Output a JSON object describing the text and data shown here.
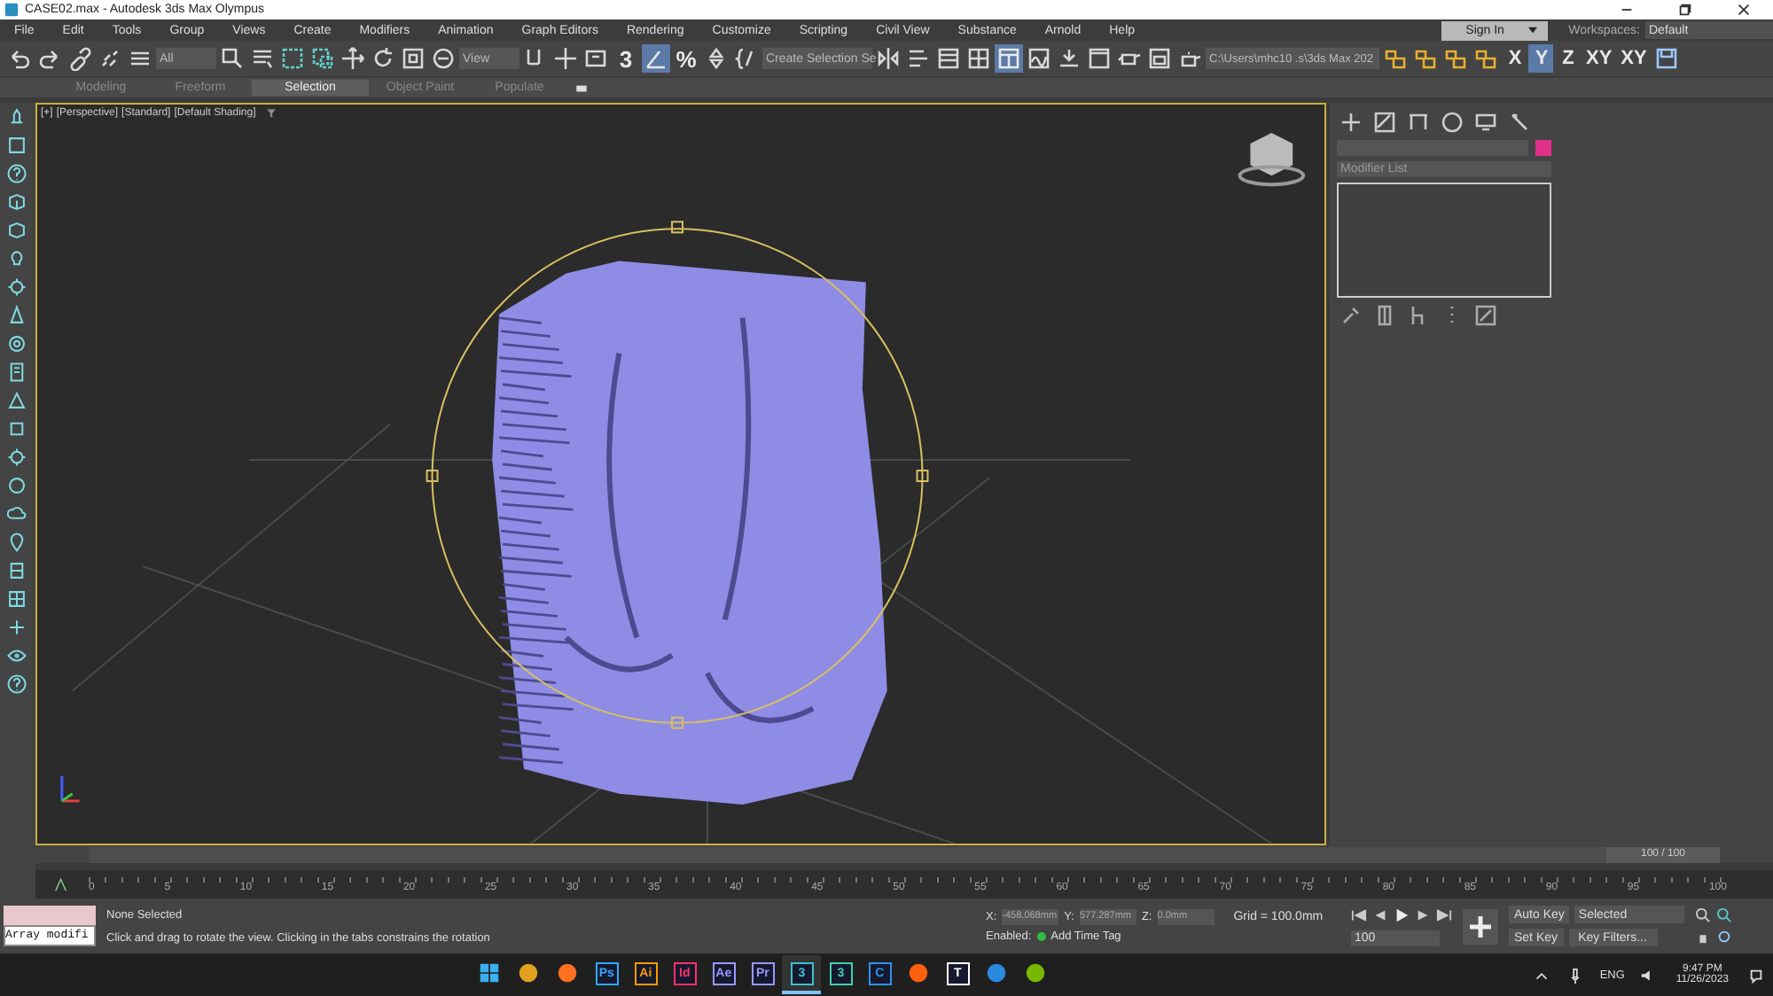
{
  "window": {
    "title": "CASE02.max - Autodesk 3ds Max Olympus"
  },
  "menu": [
    "File",
    "Edit",
    "Tools",
    "Group",
    "Views",
    "Create",
    "Modifiers",
    "Animation",
    "Graph Editors",
    "Rendering",
    "Customize",
    "Scripting",
    "Civil View",
    "Substance",
    "Arnold",
    "Help"
  ],
  "account": {
    "label": "Sign In"
  },
  "workspaces": {
    "label": "Workspaces:",
    "value": "Default"
  },
  "toolbar": {
    "selection_filter": "All",
    "reference_coord": "View",
    "snap_label": "3",
    "percent_label": "%",
    "angle_snap_on": true,
    "named_selection": "Create Selection Se",
    "ribbon_on": true,
    "project_path": "C:\\Users\\mhc10 .s\\3ds Max 202",
    "axes": [
      {
        "label": "X",
        "selected": false
      },
      {
        "label": "Y",
        "selected": true
      },
      {
        "label": "Z",
        "selected": false
      },
      {
        "label": "XY",
        "selected": false
      },
      {
        "label": "XY",
        "selected": false
      }
    ]
  },
  "ribbon": {
    "tabs": [
      {
        "label": "Modeling",
        "selected": false
      },
      {
        "label": "Freeform",
        "selected": false
      },
      {
        "label": "Selection",
        "selected": true
      },
      {
        "label": "Object Paint",
        "selected": false
      },
      {
        "label": "Populate",
        "selected": false
      }
    ]
  },
  "viewport": {
    "labels": [
      "[+]",
      "[Perspective]",
      "[Standard]",
      "[Default Shading]"
    ]
  },
  "command_panel": {
    "color": "#e0308a",
    "modifier_list": "Modifier List"
  },
  "timeline": {
    "range": "100 / 100",
    "level": 1,
    "ticks": [
      "0",
      "5",
      "10",
      "15",
      "20",
      "25",
      "30",
      "35",
      "40",
      "45",
      "50",
      "55",
      "60",
      "65",
      "70",
      "75",
      "80",
      "85",
      "90",
      "95",
      "100"
    ]
  },
  "status": {
    "script": "Array modifi",
    "selection": "None Selected",
    "prompt": "Click and drag to rotate the view.  Clicking in the tabs constrains the rotation",
    "coords": [
      {
        "label": "X:",
        "value": "-458.068mm"
      },
      {
        "label": "Y:",
        "value": "577.287mm"
      },
      {
        "label": "Z:",
        "value": "0.0mm"
      }
    ],
    "grid": "Grid = 100.0mm",
    "enabled": "Enabled:",
    "time_tag": "Add Time Tag",
    "frame": "100",
    "auto_key": "Auto Key",
    "key_mode": "Selected",
    "set_key": "Set Key",
    "key_filters": "Key Filters..."
  },
  "taskbar": {
    "apps": [
      {
        "kind": "start",
        "active": false
      },
      {
        "kind": "round",
        "color": "#e0a020",
        "active": false
      },
      {
        "kind": "round",
        "color": "#ff7020",
        "active": false
      },
      {
        "kind": "tile",
        "label": "Ps",
        "color": "#31a8ff",
        "active": false
      },
      {
        "kind": "tile",
        "label": "Ai",
        "color": "#ff9a00",
        "active": false
      },
      {
        "kind": "tile",
        "label": "Id",
        "color": "#ff3366",
        "active": false
      },
      {
        "kind": "tile",
        "label": "Ae",
        "color": "#9999ff",
        "active": false
      },
      {
        "kind": "tile",
        "label": "Pr",
        "color": "#9999ff",
        "active": false
      },
      {
        "kind": "tile",
        "label": "3",
        "color": "#40c0d0",
        "active": true
      },
      {
        "kind": "tile",
        "label": "3",
        "color": "#40d0b0",
        "active": false
      },
      {
        "kind": "tile",
        "label": "C",
        "color": "#3090f0",
        "active": false
      },
      {
        "kind": "round",
        "color": "#ff6010",
        "active": false
      },
      {
        "kind": "tile",
        "label": "T",
        "color": "#ffffff",
        "active": false
      },
      {
        "kind": "round",
        "color": "#2a8ae0",
        "active": false
      },
      {
        "kind": "round",
        "color": "#76b900",
        "active": false
      }
    ],
    "language": "ENG",
    "time": "9:47 PM",
    "date": "11/26/2023"
  }
}
